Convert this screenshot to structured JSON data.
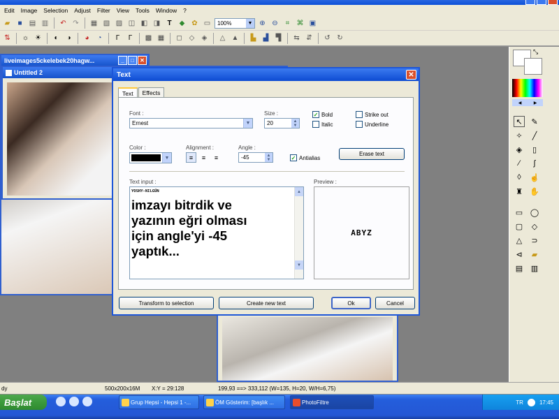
{
  "menubar": [
    "Edit",
    "Image",
    "Selection",
    "Adjust",
    "Filter",
    "View",
    "Tools",
    "Window",
    "?"
  ],
  "toolbar": {
    "zoom_value": "100%"
  },
  "doc_windows": {
    "back_title": "liveimages5ckelebek20hagw...",
    "front_title": "Untitled 2"
  },
  "dialog": {
    "title": "Text",
    "tabs": [
      "Text",
      "Effects"
    ],
    "font_label": "Font :",
    "font_value": "Ernest",
    "size_label": "Size :",
    "size_value": "20",
    "bold_label": "Bold",
    "bold_checked": true,
    "italic_label": "Italic",
    "strikeout_label": "Strike out",
    "underline_label": "Underline",
    "color_label": "Color :",
    "color_value": "#000000",
    "alignment_label": "Alignment :",
    "angle_label": "Angle :",
    "angle_value": "-45",
    "antialias_label": "Antialias",
    "antialias_checked": true,
    "erase_text_label": "Erase text",
    "text_input_label": "Text input :",
    "text_input_small": "YOSHY-NILGÜN",
    "text_input_big": "imzayı bitrdik ve\nyazının eğri olması\niçin angle'yi -45\nyaptık...",
    "preview_label": "Preview :",
    "preview_text": "ABYZ",
    "transform_label": "Transform to selection",
    "create_label": "Create new text",
    "ok_label": "Ok",
    "cancel_label": "Cancel"
  },
  "statusbar": {
    "left": "dy",
    "image_info": "500x200x16M",
    "xy": "X:Y = 29:128",
    "selection": "199,93 ==> 333,112 (W=135, H=20, W/H=6,75)"
  },
  "taskbar": {
    "start_label": "Başlat",
    "tasks": [
      "Grup Hepsi - Hepsi 1 -...",
      "ÖM Gösterim: [başlık ...",
      "PhotoFiltre"
    ],
    "lang": "TR",
    "clock": "17:45"
  },
  "colors": {
    "accent": "#0b4fd8",
    "dialog_border": "#1d56d8",
    "taskbar": "#245edc",
    "start": "#3b9a3b"
  }
}
